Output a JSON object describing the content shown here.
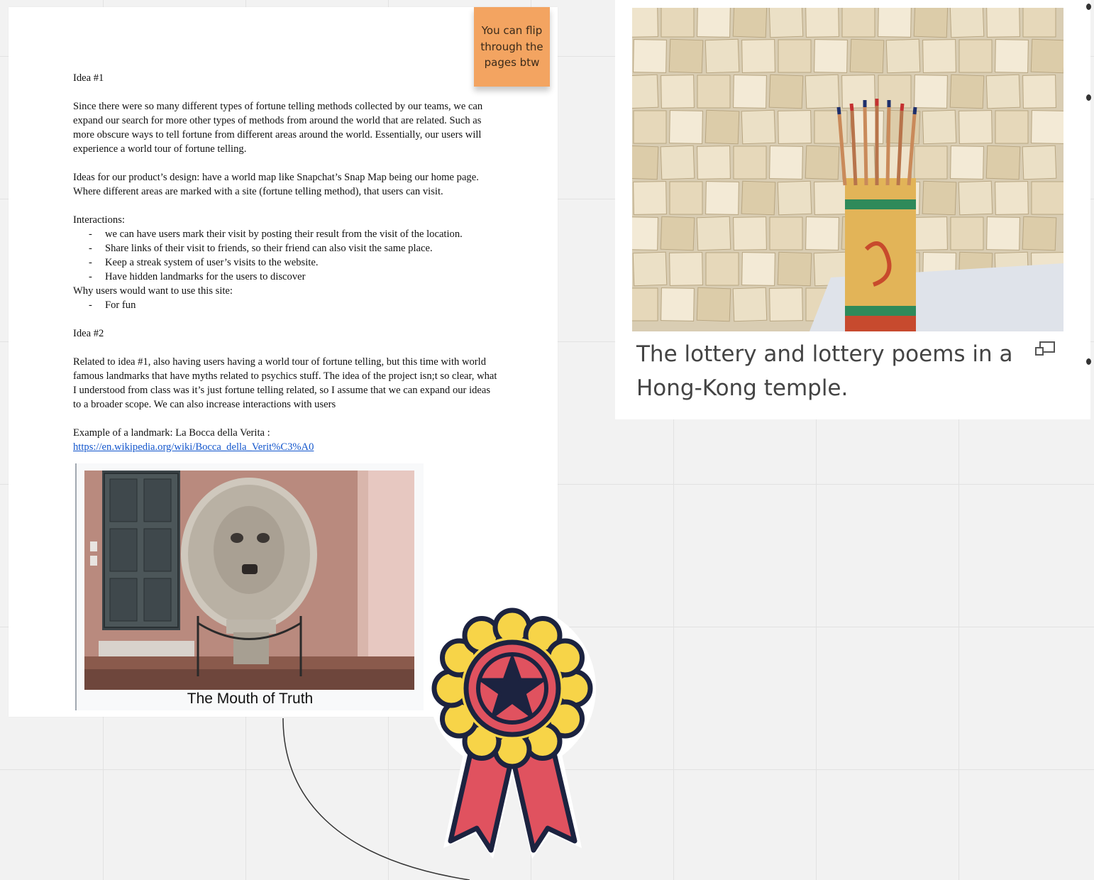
{
  "document": {
    "idea1_heading": "Idea #1",
    "idea1_paragraph": "Since there were so many different types of fortune telling methods collected by our teams, we can expand our search for more other types of methods from around the world that are related. Such as more obscure ways to tell fortune from different areas around the world. Essentially, our users will experience a world tour of fortune telling.",
    "design_paragraph": "Ideas for our product’s design: have a world map like Snapchat’s Snap Map being our home page. Where different areas are marked with a site (fortune telling method), that users can visit.",
    "interactions_heading": "Interactions:",
    "interactions": [
      "we can have users mark their visit by posting their result from the visit of the location.",
      "Share links of their visit to friends, so their friend can also visit the same place.",
      "Keep a streak system of user’s visits to the website.",
      "Have hidden landmarks for the users to discover"
    ],
    "why_heading": "Why users would want to use this site:",
    "why_items": [
      "For fun"
    ],
    "idea2_heading": "Idea #2",
    "idea2_paragraph": "Related to idea #1, also having users having a world tour of fortune telling, but this time with world famous landmarks that have myths related to psychics stuff. The idea of the project isn;t so clear, what I understood from class was it’s just fortune telling related, so I assume that we can expand our ideas to a broader scope. We can also increase interactions with users",
    "example_text": "Example of a landmark: La Bocca della Verita :",
    "example_link": "https://en.wikipedia.org/wiki/Bocca_della_Verit%C3%A0",
    "figure_caption": "The Mouth of Truth"
  },
  "sticky_note": {
    "text": "You can flip through the pages btw",
    "color": "#f3a461"
  },
  "image_card": {
    "caption": "The lottery and lottery poems in a Hong-Kong temple.",
    "icon": "enlarge-icon"
  },
  "sticker": {
    "icon": "award-ribbon-icon",
    "colors": {
      "petals": "#f7d448",
      "medal": "#e0525f",
      "outline": "#1c2340"
    }
  },
  "colors": {
    "canvas": "#f2f2f2",
    "grid": "#e2e2e2",
    "link": "#1155cc"
  }
}
